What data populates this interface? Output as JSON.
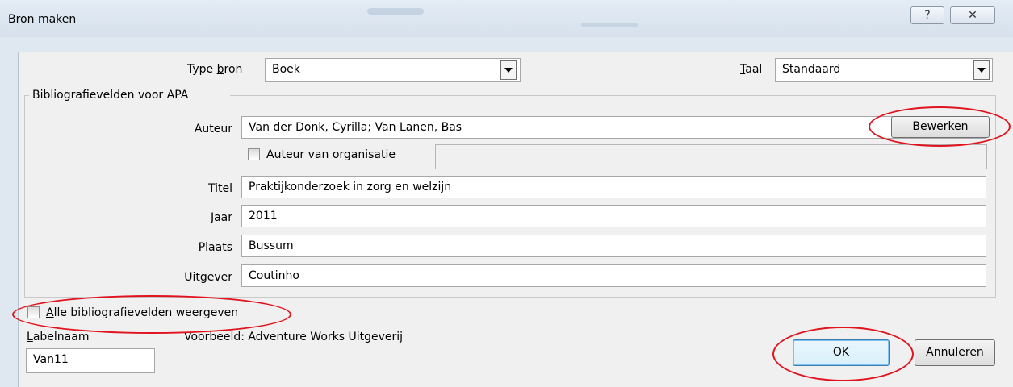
{
  "window": {
    "title": "Bron maken",
    "help_glyph": "?",
    "close_glyph": "✕"
  },
  "header": {
    "type_label_pre": "Type ",
    "type_label_accel": "b",
    "type_label_post": "ron",
    "type_value": "Boek",
    "lang_label_accel": "T",
    "lang_label_post": "aal",
    "lang_value": "Standaard"
  },
  "group": {
    "title": "Bibliografievelden voor APA"
  },
  "fields": {
    "auteur_label": "Auteur",
    "auteur_value": "Van der Donk, Cyrilla; Van Lanen, Bas",
    "bewerken_label": "Bewerken",
    "org_checkbox_label": "Auteur van organisatie",
    "org_value": "",
    "titel_label": "Titel",
    "titel_value": "Praktijkonderzoek in zorg en welzijn",
    "jaar_label": "Jaar",
    "jaar_value": "2011",
    "plaats_label": "Plaats",
    "plaats_value": "Bussum",
    "uitgever_label": "Uitgever",
    "uitgever_value": "Coutinho"
  },
  "footer": {
    "alle_accel": "A",
    "alle_post": "lle bibliografievelden weergeven",
    "labelnaam_accel": "L",
    "labelnaam_post": "abelnaam",
    "labelnaam_value": "Van11",
    "voorbeeld_text": "Voorbeeld: Adventure Works Uitgeverij",
    "ok_label": "OK",
    "annuleren_label": "Annuleren"
  },
  "annotation_color": "#e0141e"
}
